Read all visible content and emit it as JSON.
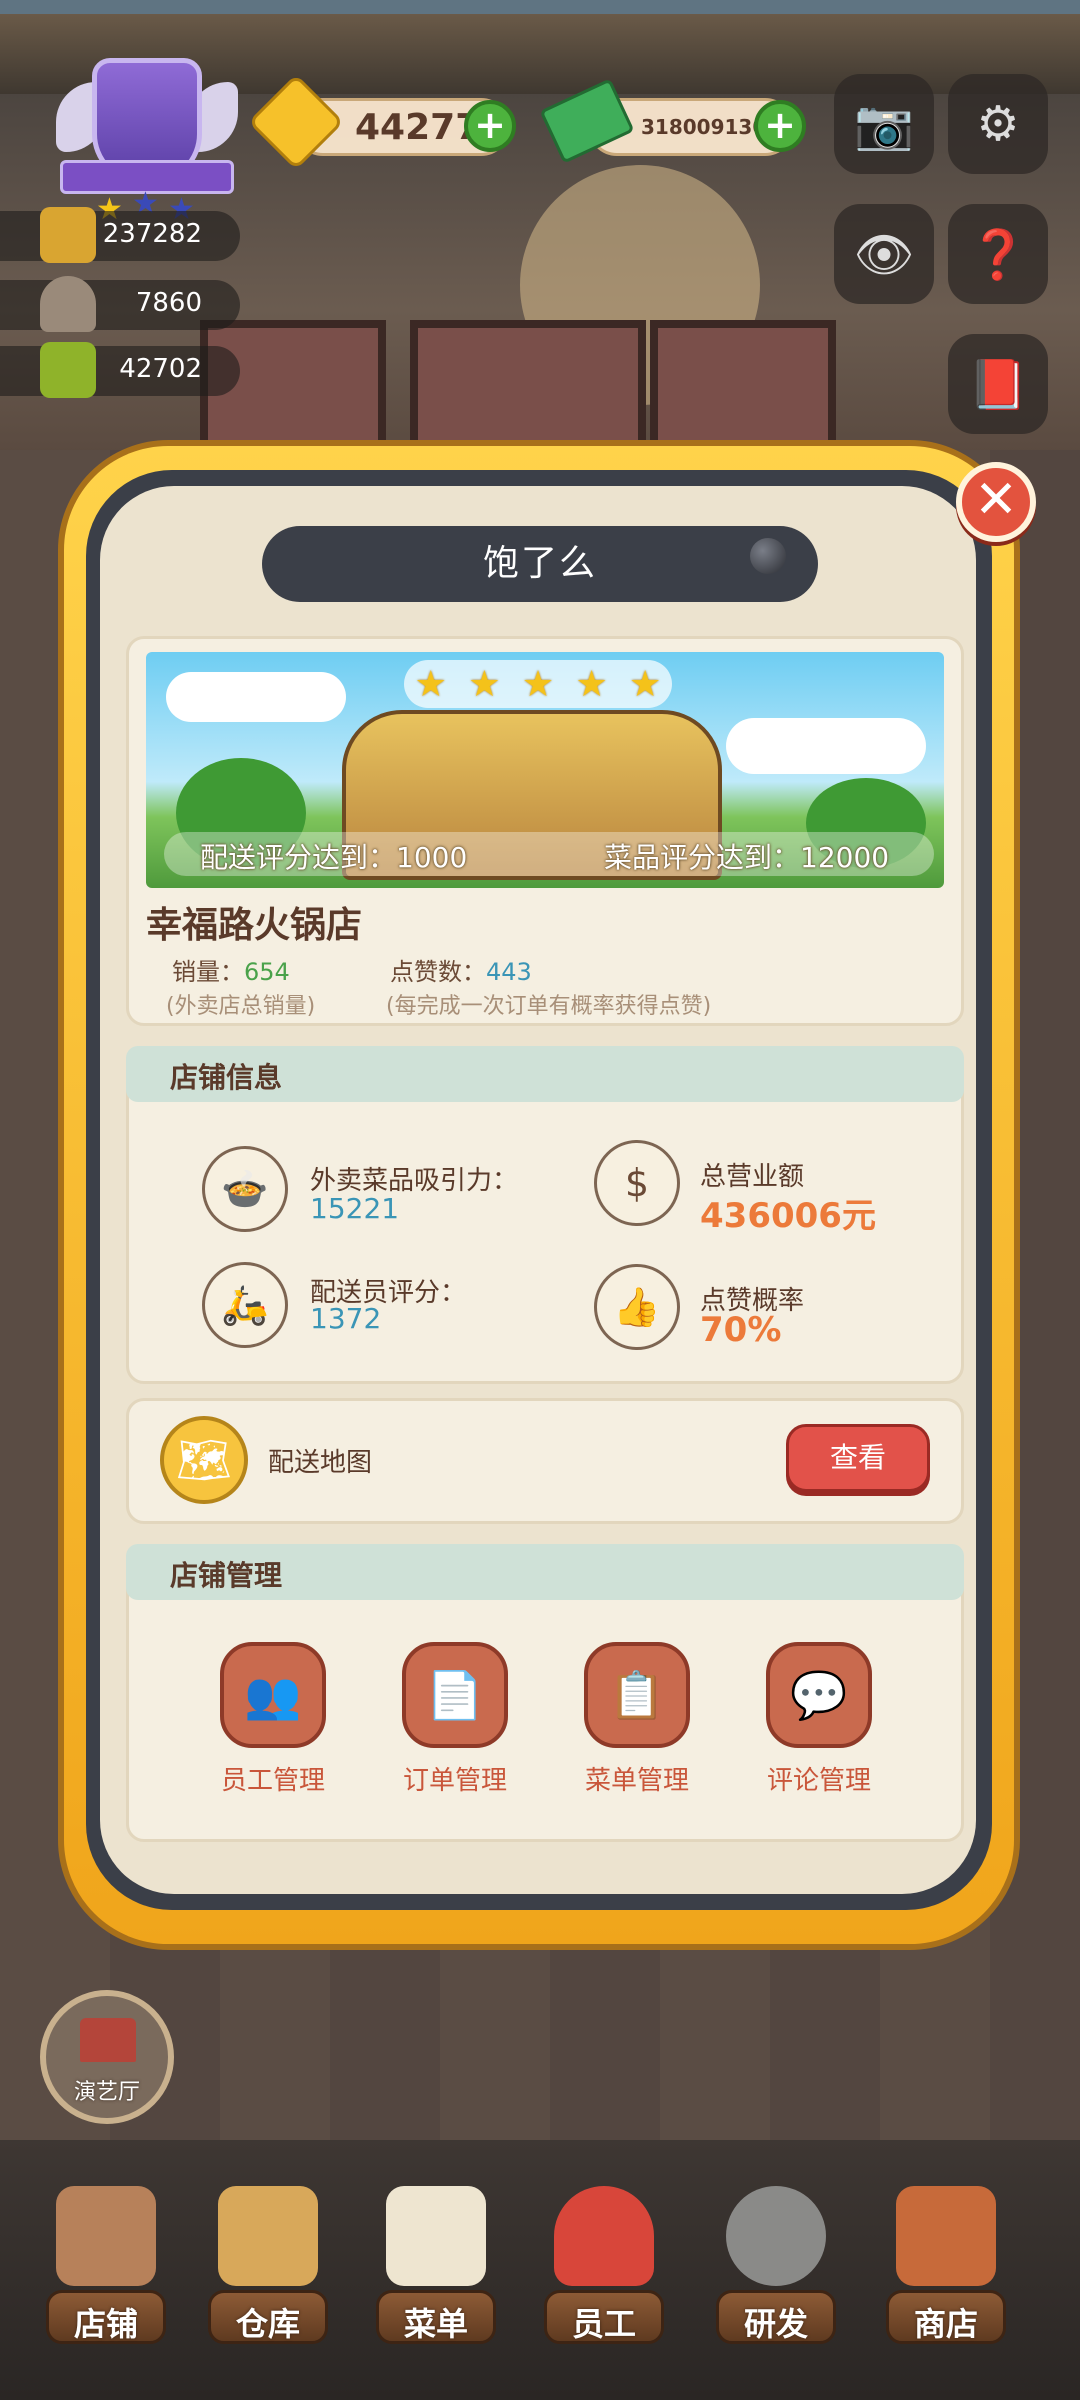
{
  "hud": {
    "gems": "44277",
    "cash": "318009130",
    "stats": [
      "237282",
      "7860",
      "42702"
    ]
  },
  "dialog": {
    "title": "饱了么",
    "requirement_delivery": "配送评分达到：1000",
    "requirement_dish": "菜品评分达到：12000",
    "shop_name": "幸福路火锅店",
    "sales_label": "销量：",
    "sales_value": "654",
    "likes_label": "点赞数：",
    "likes_value": "443",
    "sales_note": "(外卖店总销量)",
    "likes_note": "(每完成一次订单有概率获得点赞)",
    "shop_info": {
      "header": "店铺信息",
      "attract_label": "外卖菜品吸引力：",
      "attract_value": "15221",
      "revenue_label": "总营业额",
      "revenue_value": "436006元",
      "courier_label": "配送员评分：",
      "courier_value": "1372",
      "like_rate_label": "点赞概率",
      "like_rate_value": "70%"
    },
    "map": {
      "label": "配送地图",
      "button": "查看"
    },
    "management": {
      "header": "店铺管理",
      "items": [
        "员工管理",
        "订单管理",
        "菜单管理",
        "评论管理"
      ]
    }
  },
  "hall_button": "演艺厅",
  "bottom_nav": [
    "店铺",
    "仓库",
    "菜单",
    "员工",
    "研发",
    "商店"
  ],
  "colors": {
    "accent_green": "#4aa24a",
    "accent_blue": "#3a95b6",
    "accent_orange": "#ec7a3a",
    "button_red": "#e2524a",
    "frame_gold": "#f0a51b"
  }
}
